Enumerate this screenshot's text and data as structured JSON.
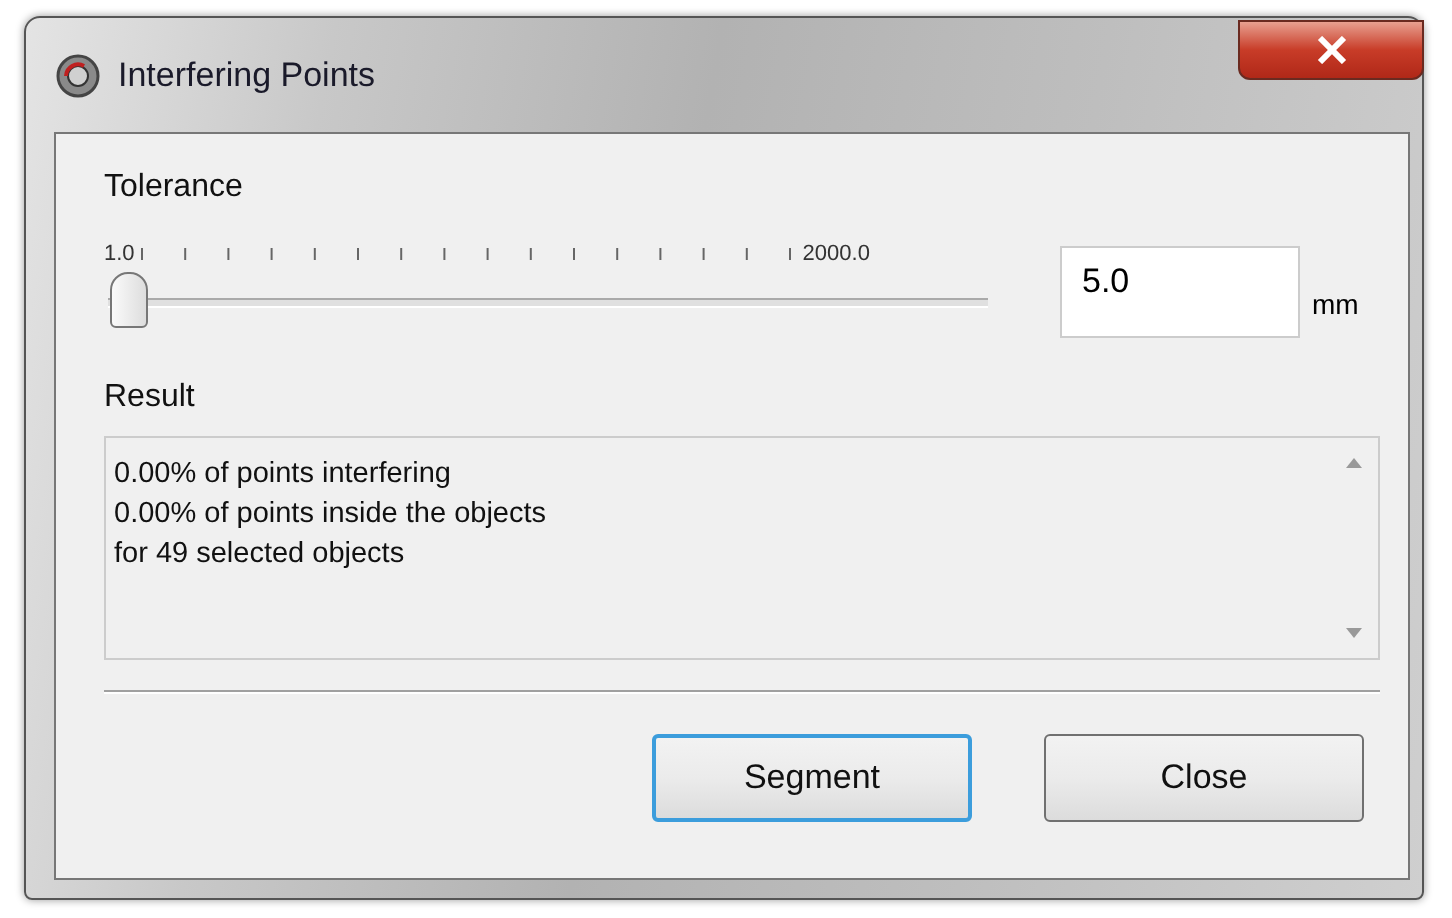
{
  "window": {
    "title": "Interfering Points"
  },
  "tolerance": {
    "label": "Tolerance",
    "min_label": "1.0",
    "max_label": "2000.0",
    "level": 0.002,
    "value": "5.0",
    "unit": "mm"
  },
  "result": {
    "label": "Result",
    "lines": [
      "0.00% of points interfering",
      "0.00% of points inside the objects",
      "for 49 selected objects"
    ]
  },
  "buttons": [
    {
      "label": "Segment",
      "focused": true
    },
    {
      "label": "Close",
      "focused": false
    }
  ]
}
